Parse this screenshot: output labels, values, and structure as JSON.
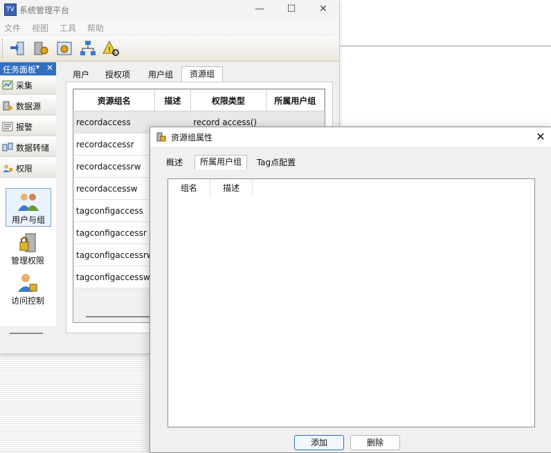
{
  "window": {
    "title": "系统管理平台",
    "app_icon": "app-icon",
    "minimize": "—",
    "maximize": "☐",
    "close": "✕"
  },
  "menu": [
    "文件",
    "视图",
    "工具",
    "帮助"
  ],
  "toolbar": {
    "icons": [
      "arrow-swap-icon",
      "gear-wrench-icon",
      "gear-settings-icon",
      "network-icon",
      "alarm-search-icon"
    ]
  },
  "task_panel": {
    "title": "任务面板",
    "pin": "▾",
    "close": "✕",
    "categories": [
      {
        "label": "采集",
        "icon": "collect-icon"
      },
      {
        "label": "数据源",
        "icon": "datasource-icon"
      },
      {
        "label": "报警",
        "icon": "alarm-icon"
      },
      {
        "label": "数据转储",
        "icon": "dump-icon"
      },
      {
        "label": "权限",
        "icon": "permission-icon"
      }
    ],
    "items": [
      {
        "label": "用户与组",
        "icon": "users-groups-icon"
      },
      {
        "label": "管理权限",
        "icon": "manage-permission-icon"
      },
      {
        "label": "访问控制",
        "icon": "access-control-icon"
      }
    ]
  },
  "tabs": [
    "用户",
    "授权项",
    "用户组",
    "资源组"
  ],
  "active_tab": "资源组",
  "resource_table": {
    "columns": [
      "资源组名",
      "描述",
      "权限类型",
      "所属用户组"
    ],
    "rows": [
      [
        "recordaccess",
        "",
        "record access()",
        ""
      ],
      [
        "recordaccessr",
        "",
        "",
        ""
      ],
      [
        "recordaccessrw",
        "",
        "",
        ""
      ],
      [
        "recordaccessw",
        "",
        "",
        ""
      ],
      [
        "tagconfigaccess",
        "",
        "",
        ""
      ],
      [
        "tagconfigaccessr",
        "",
        "",
        ""
      ],
      [
        "tagconfigaccessrw",
        "",
        "",
        ""
      ],
      [
        "tagconfigaccessw",
        "",
        "",
        ""
      ]
    ]
  },
  "dialog": {
    "title": "资源组属性",
    "close": "✕",
    "tabs": [
      "概述",
      "所属用户组",
      "Tag点配置"
    ],
    "active_tab": "所属用户组",
    "list_columns": [
      "组名",
      "描述"
    ],
    "buttons": {
      "add": "添加",
      "delete": "删除"
    }
  },
  "colors": {
    "task_header": "#2f6fc0",
    "accent": "#2a6fc6"
  }
}
